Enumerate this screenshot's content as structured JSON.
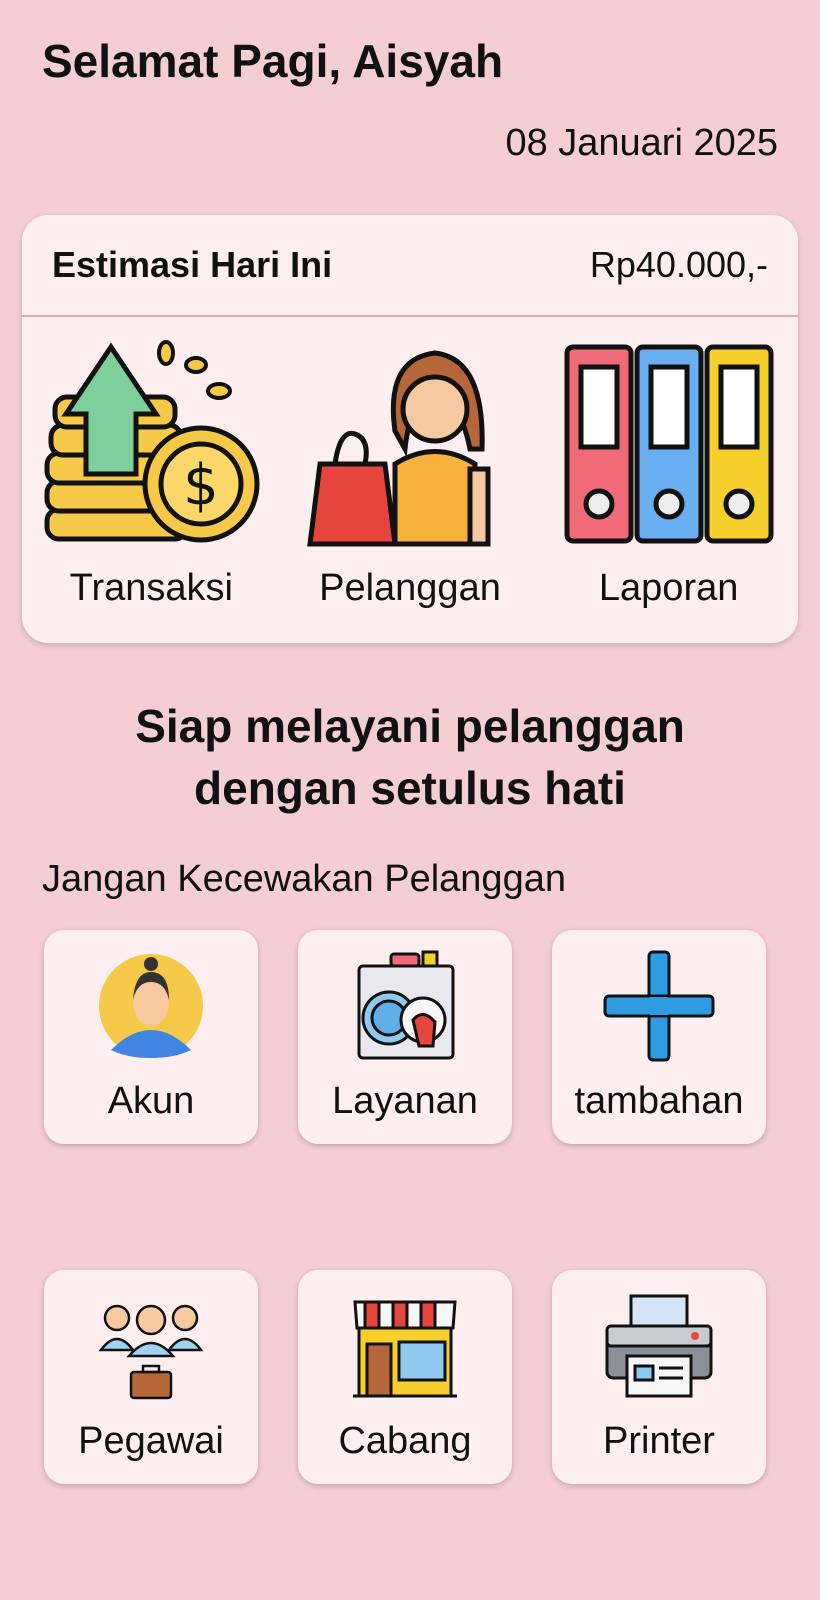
{
  "header": {
    "greeting": "Selamat Pagi, Aisyah",
    "date": "08 Januari 2025"
  },
  "summary": {
    "title": "Estimasi Hari Ini",
    "amount": "Rp40.000,-",
    "items": [
      {
        "label": "Transaksi",
        "icon": "money-coins-icon"
      },
      {
        "label": "Pelanggan",
        "icon": "customer-shopping-icon"
      },
      {
        "label": "Laporan",
        "icon": "binders-icon"
      }
    ]
  },
  "tagline": {
    "line1": "Siap melayani pelanggan",
    "line2": "dengan setulus hati"
  },
  "subtitle": "Jangan Kecewakan Pelanggan",
  "tiles": [
    {
      "label": "Akun",
      "icon": "user-avatar-icon"
    },
    {
      "label": "Layanan",
      "icon": "washing-machine-icon"
    },
    {
      "label": "tambahan",
      "icon": "plus-icon"
    },
    {
      "label": "Pegawai",
      "icon": "employees-icon"
    },
    {
      "label": "Cabang",
      "icon": "store-icon"
    },
    {
      "label": "Printer",
      "icon": "printer-icon"
    }
  ],
  "colors": {
    "background": "#f4cdd5",
    "card": "#fdeff0",
    "plus_blue": "#2f9be3"
  }
}
